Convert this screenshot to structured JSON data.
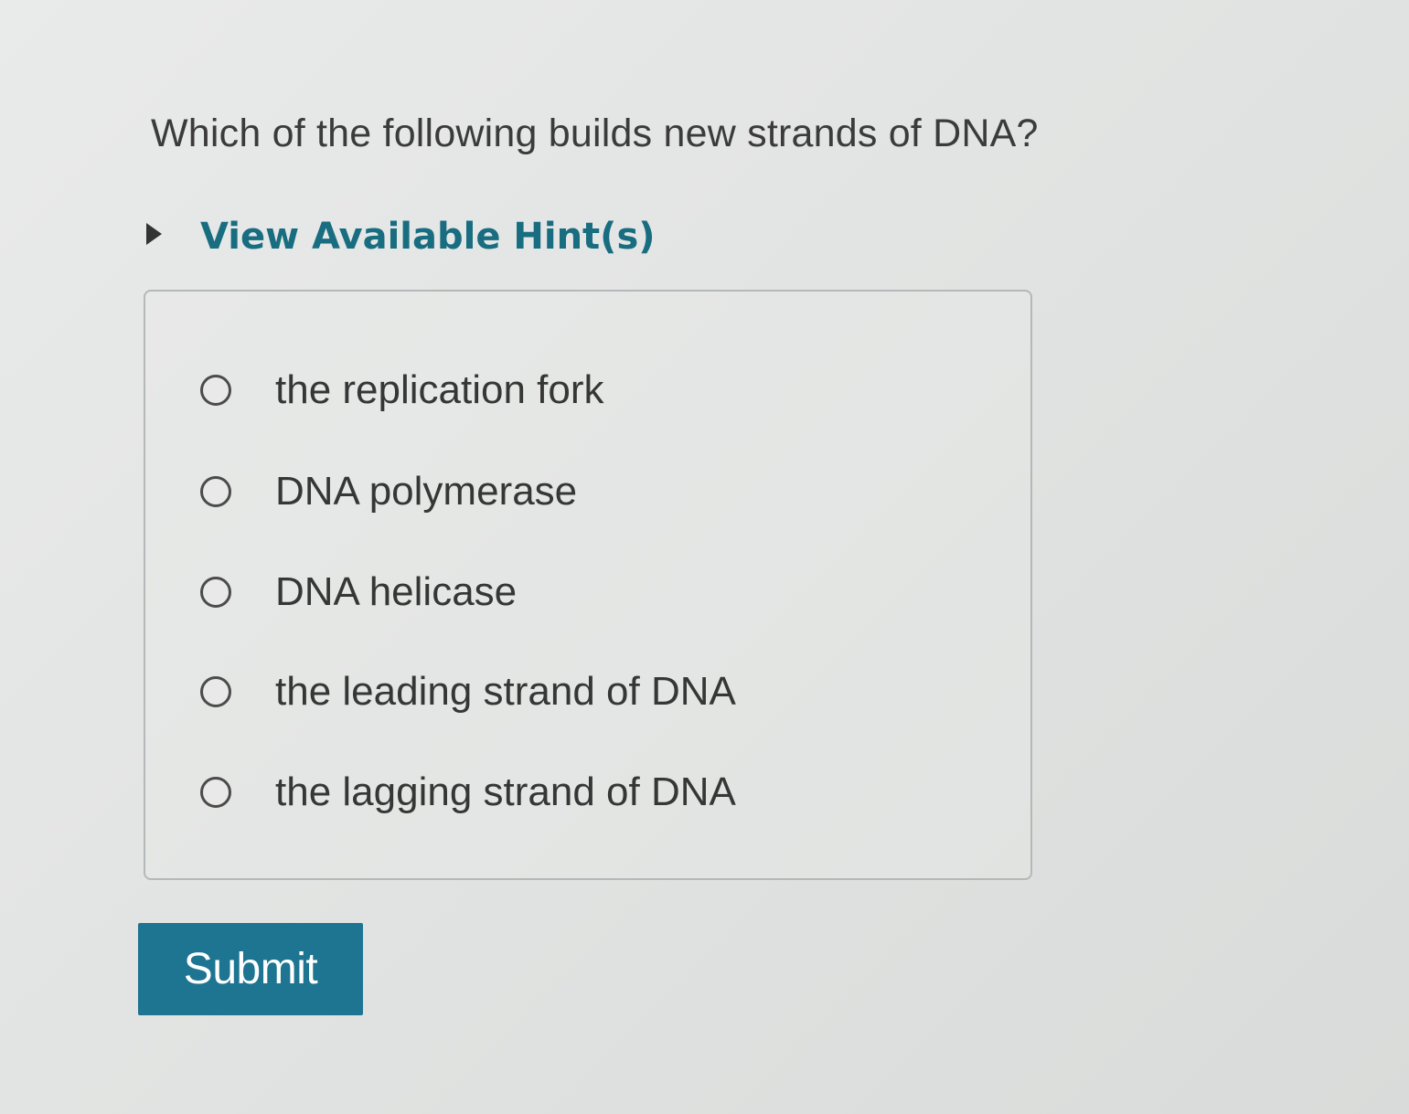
{
  "question": {
    "text": "Which of the following builds new strands of DNA?"
  },
  "hint": {
    "label": "View Available Hint(s)",
    "expanded": false
  },
  "options": [
    {
      "label": "the replication fork",
      "selected": false
    },
    {
      "label": "DNA polymerase",
      "selected": false
    },
    {
      "label": "DNA helicase",
      "selected": false
    },
    {
      "label": "the leading strand of DNA",
      "selected": false
    },
    {
      "label": "the lagging strand of DNA",
      "selected": false
    }
  ],
  "submit": {
    "label": "Submit"
  },
  "colors": {
    "hint_text": "#186d80",
    "submit_background": "#1e7591",
    "submit_text": "#ffffff"
  }
}
